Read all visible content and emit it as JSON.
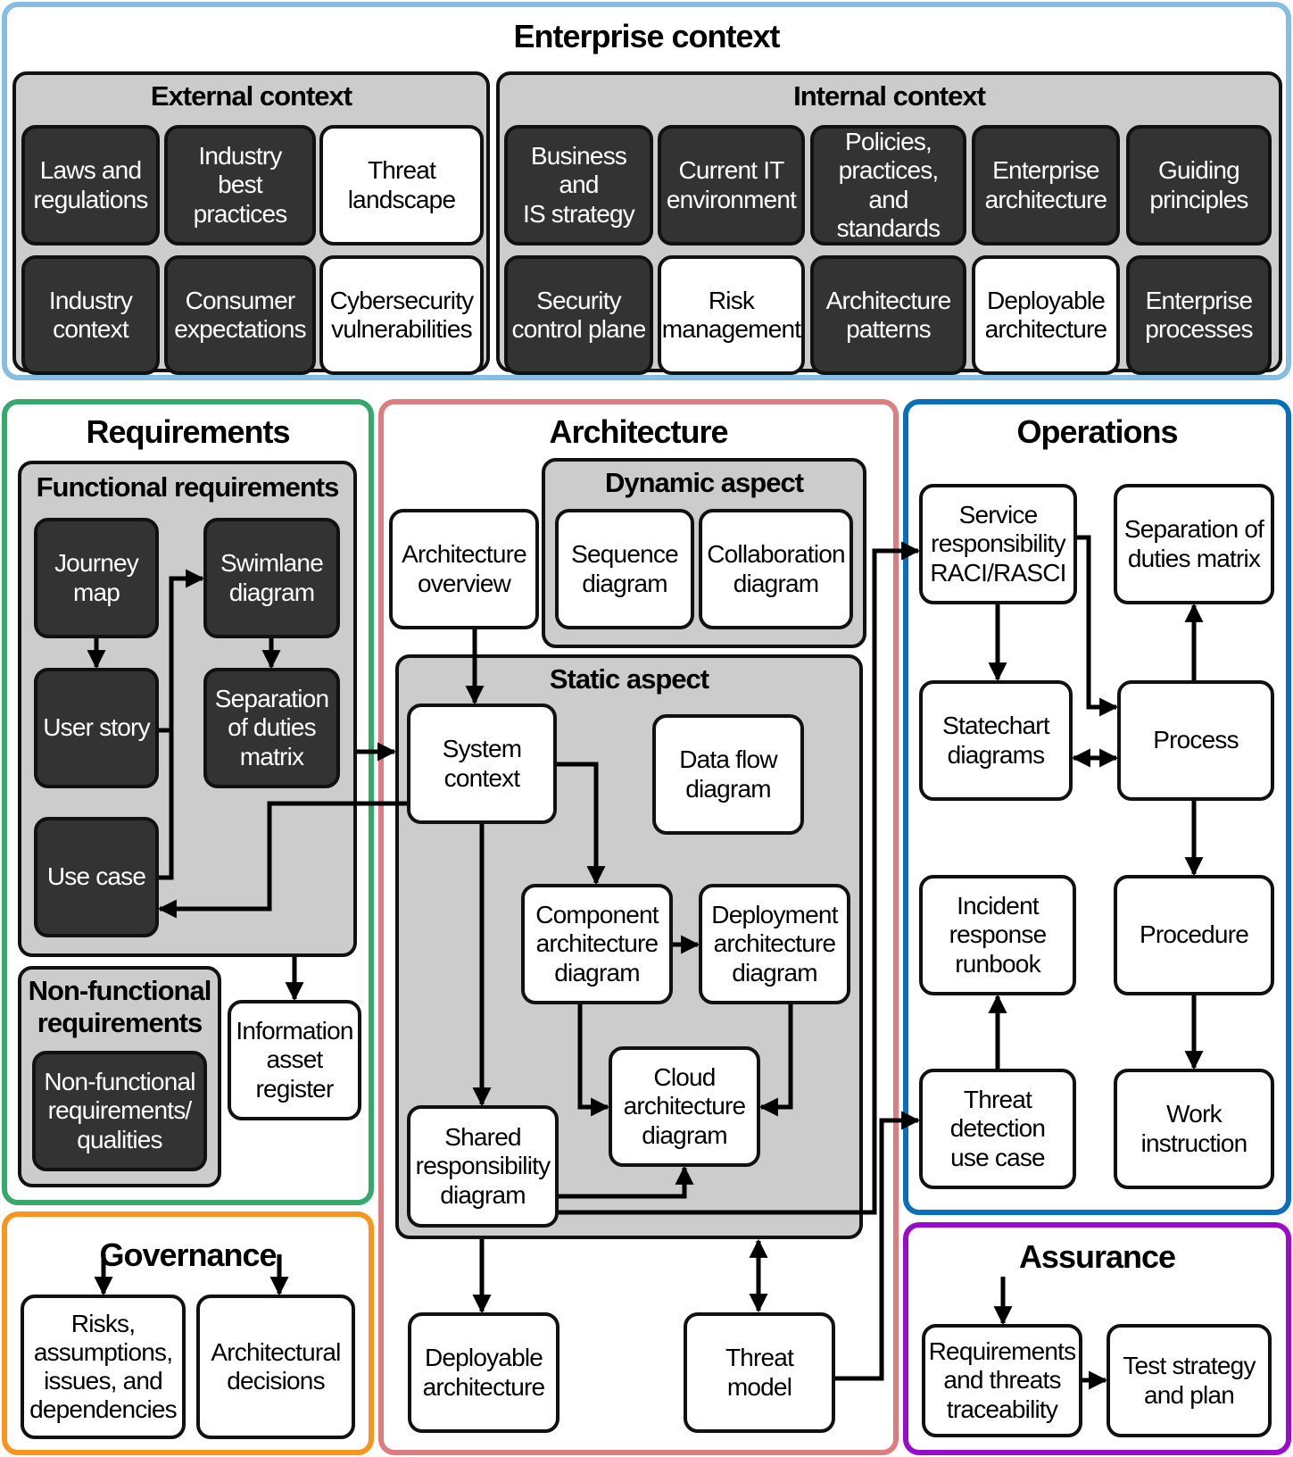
{
  "colors": {
    "enterprise_border": "#85bde3",
    "requirements_border": "#35a86b",
    "architecture_border": "#dd7d80",
    "operations_border": "#0a6fba",
    "governance_border": "#f7951e",
    "assurance_border": "#9b0bcc",
    "group_fill": "#cccccc",
    "dark_box_fill": "#333333"
  },
  "enterprise": {
    "title": "Enterprise context",
    "external": {
      "title": "External context",
      "items": [
        {
          "label": "Laws and\nregulations",
          "style": "dark"
        },
        {
          "label": "Industry\nbest\npractices",
          "style": "dark"
        },
        {
          "label": "Threat\nlandscape",
          "style": "light"
        },
        {
          "label": "Industry\ncontext",
          "style": "dark"
        },
        {
          "label": "Consumer\nexpectations",
          "style": "dark"
        },
        {
          "label": "Cybersecurity\nvulnerabilities",
          "style": "light"
        }
      ]
    },
    "internal": {
      "title": "Internal context",
      "items": [
        {
          "label": "Business and\nIS strategy",
          "style": "dark"
        },
        {
          "label": "Current IT\nenvironment",
          "style": "dark"
        },
        {
          "label": "Policies,\npractices, and\nstandards",
          "style": "dark"
        },
        {
          "label": "Enterprise\narchitecture",
          "style": "dark"
        },
        {
          "label": "Guiding\nprinciples",
          "style": "dark"
        },
        {
          "label": "Security\ncontrol plane",
          "style": "dark"
        },
        {
          "label": "Risk\nmanagement",
          "style": "light"
        },
        {
          "label": "Architecture\npatterns",
          "style": "dark"
        },
        {
          "label": "Deployable\narchitecture",
          "style": "light"
        },
        {
          "label": "Enterprise\nprocesses",
          "style": "dark"
        }
      ]
    }
  },
  "requirements": {
    "title": "Requirements",
    "functional": {
      "title": "Functional requirements",
      "journey_map": "Journey\nmap",
      "user_story": "User story",
      "use_case": "Use case",
      "swimlane": "Swimlane\ndiagram",
      "separation": "Separation\nof duties\nmatrix"
    },
    "non_functional": {
      "title": "Non-functional\nrequirements",
      "item": "Non-functional\nrequirements/\nqualities"
    },
    "info_asset": "Information\nasset\nregister"
  },
  "governance": {
    "title": "Governance",
    "risks": "Risks,\nassumptions,\nissues, and\ndependencies",
    "decisions": "Architectural\ndecisions"
  },
  "architecture": {
    "title": "Architecture",
    "overview": "Architecture\noverview",
    "dynamic": {
      "title": "Dynamic aspect",
      "sequence": "Sequence\ndiagram",
      "collaboration": "Collaboration\ndiagram"
    },
    "static": {
      "title": "Static aspect",
      "system_context": "System\ncontext",
      "data_flow": "Data flow\ndiagram",
      "component": "Component\narchitecture\ndiagram",
      "deployment": "Deployment\narchitecture\ndiagram",
      "cloud": "Cloud\narchitecture\ndiagram",
      "shared": "Shared\nresponsibility\ndiagram"
    },
    "deployable": "Deployable\narchitecture",
    "threat_model": "Threat\nmodel"
  },
  "operations": {
    "title": "Operations",
    "service_resp": "Service\nresponsibility\nRACI/RASCI",
    "separation": "Separation of\nduties matrix",
    "statechart": "Statechart\ndiagrams",
    "process": "Process",
    "incident": "Incident\nresponse\nrunbook",
    "procedure": "Procedure",
    "threat_detection": "Threat\ndetection\nuse case",
    "work_instruction": "Work\ninstruction"
  },
  "assurance": {
    "title": "Assurance",
    "traceability": "Requirements\nand threats\ntraceability",
    "test_strategy": "Test strategy\nand plan"
  }
}
